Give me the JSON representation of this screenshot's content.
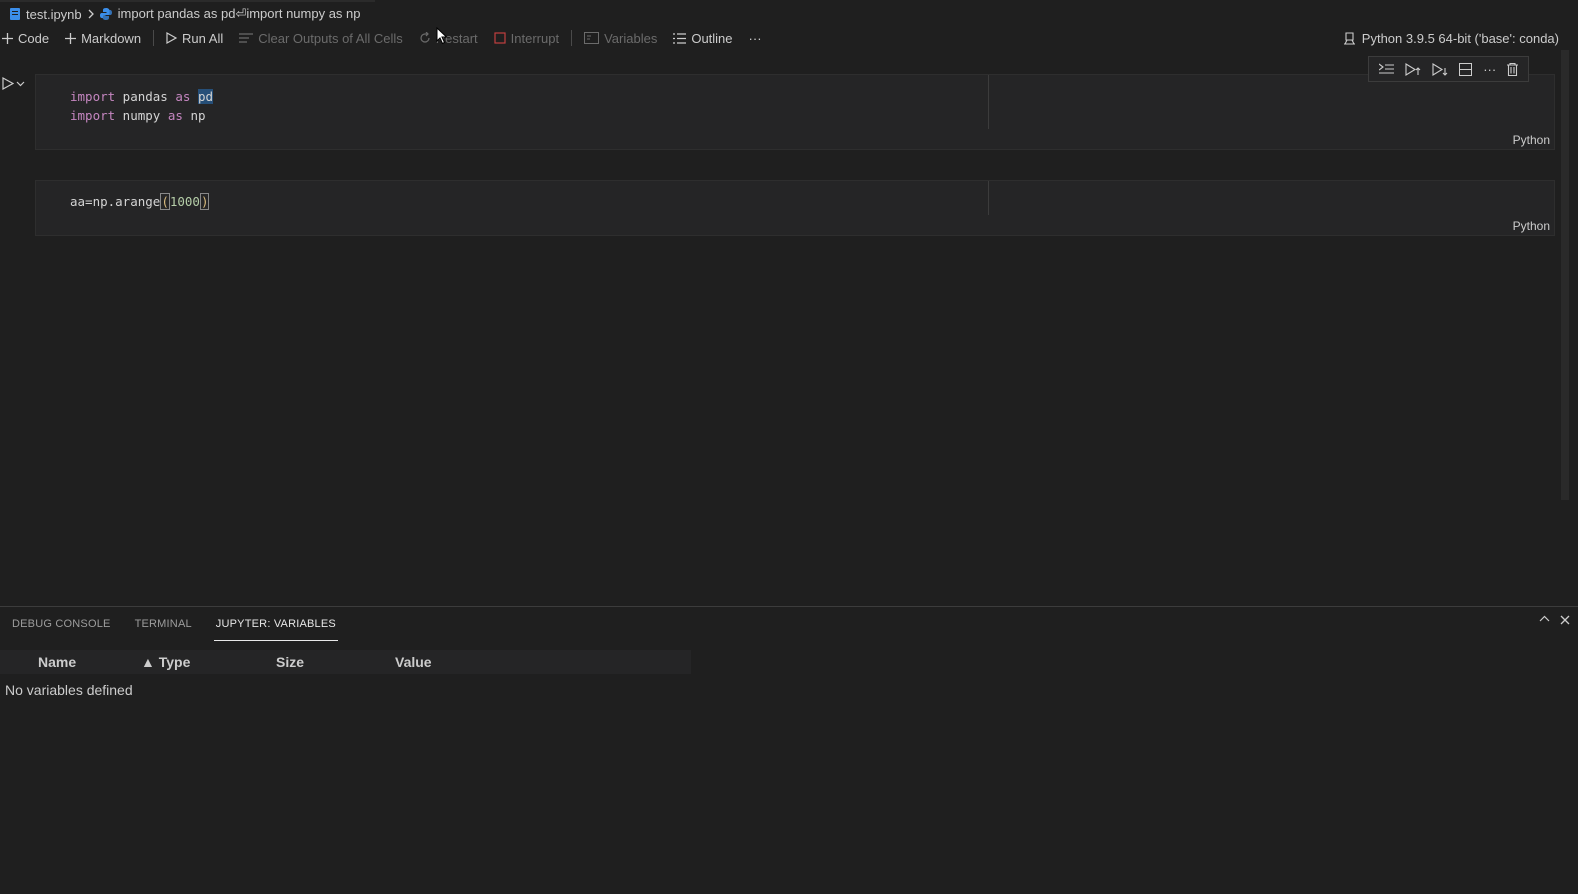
{
  "breadcrumb": {
    "file": "test.ipynb",
    "separator": ">",
    "cell": "import pandas as pd⏎import numpy as np"
  },
  "toolbar": {
    "code": "Code",
    "markdown": "Markdown",
    "run_all": "Run All",
    "clear_outputs": "Clear Outputs of All Cells",
    "restart": "Restart",
    "interrupt": "Interrupt",
    "variables": "Variables",
    "outline": "Outline",
    "more": "···",
    "kernel": "Python 3.9.5 64-bit ('base': conda)"
  },
  "cells": [
    {
      "lines": [
        {
          "kw1": "import",
          "mod": " pandas ",
          "kw2": "as",
          "sp": " ",
          "alias": "pd"
        },
        {
          "kw1": "import",
          "mod": " numpy ",
          "kw2": "as",
          "sp": " ",
          "alias": "np"
        }
      ],
      "language": "Python"
    },
    {
      "code_prefix": "aa=np.arange",
      "open": "(",
      "arg": "1000",
      "close": ")",
      "language": "Python"
    }
  ],
  "cell_toolbar": [
    "run-by-line-icon",
    "run-above-icon",
    "run-below-icon",
    "split-cell-icon",
    "more-icon",
    "delete-icon"
  ],
  "panel": {
    "tabs": [
      "DEBUG CONSOLE",
      "TERMINAL",
      "JUPYTER: VARIABLES"
    ],
    "active_tab": "JUPYTER: VARIABLES",
    "columns": {
      "name": "Name",
      "type": "▲ Type",
      "size": "Size",
      "value": "Value"
    },
    "empty_message": "No variables defined"
  },
  "colors": {
    "background": "#1f1f1f",
    "keyword": "#c586c0",
    "selection": "#264f78"
  }
}
